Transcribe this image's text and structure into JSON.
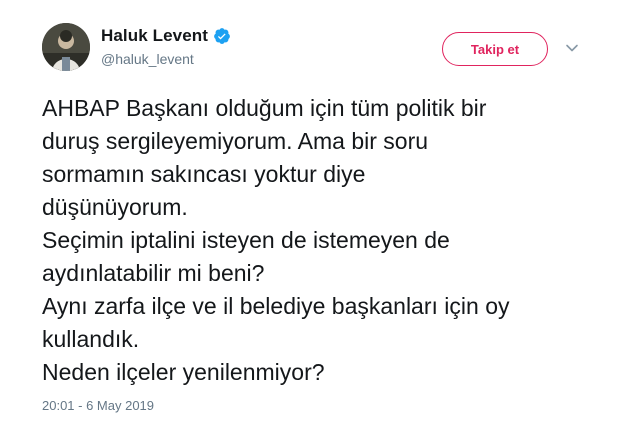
{
  "user": {
    "display_name": "Haluk Levent",
    "handle": "@haluk_levent",
    "verified": true,
    "avatar_icon": "profile-photo"
  },
  "actions": {
    "follow_label": "Takip et",
    "menu_icon": "chevron-down-icon"
  },
  "tweet": {
    "lines": [
      "AHBAP Başkanı olduğum için tüm politik bir",
      "duruş sergileyemiyorum. Ama bir soru",
      "sormamın sakıncası yoktur diye",
      "düşünüyorum.",
      "Seçimin iptalini isteyen de istemeyen de",
      "aydınlatabilir mi beni?",
      "Aynı zarfa ilçe ve il belediye başkanları için oy",
      "kullandık.",
      "Neden ilçeler yenilenmiyor?"
    ],
    "timestamp": "20:01 - 6 May 2019"
  },
  "colors": {
    "follow_accent": "#e0245e",
    "verified_blue": "#1da1f2",
    "secondary_text": "#657786",
    "primary_text": "#14171a"
  }
}
